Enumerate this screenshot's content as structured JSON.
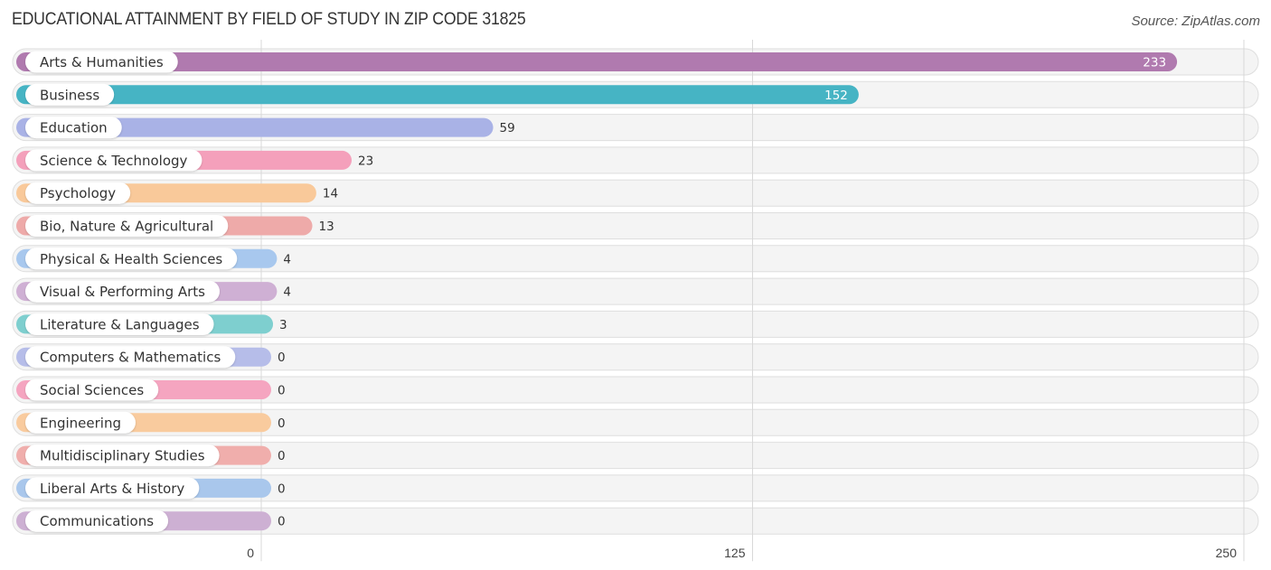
{
  "title": "EDUCATIONAL ATTAINMENT BY FIELD OF STUDY IN ZIP CODE 31825",
  "source": "Source: ZipAtlas.com",
  "chart_data": {
    "type": "bar",
    "orientation": "horizontal",
    "title": "EDUCATIONAL ATTAINMENT BY FIELD OF STUDY IN ZIP CODE 31825",
    "xlabel": "",
    "ylabel": "",
    "xlim": [
      0,
      250
    ],
    "xticks": [
      0,
      125,
      250
    ],
    "xtick_labels": [
      "0",
      "125",
      "250"
    ],
    "grid": true,
    "categories": [
      "Arts & Humanities",
      "Business",
      "Education",
      "Science & Technology",
      "Psychology",
      "Bio, Nature & Agricultural",
      "Physical & Health Sciences",
      "Visual & Performing Arts",
      "Literature & Languages",
      "Computers & Mathematics",
      "Social Sciences",
      "Engineering",
      "Multidisciplinary Studies",
      "Liberal Arts & History",
      "Communications"
    ],
    "values": [
      233,
      152,
      59,
      23,
      14,
      13,
      4,
      4,
      3,
      0,
      0,
      0,
      0,
      0,
      0
    ],
    "colors": [
      "#b07aaf",
      "#46b4c4",
      "#a9b2e6",
      "#f4a0bb",
      "#f9c99a",
      "#eeaaa9",
      "#a8c8ee",
      "#cfb0d4",
      "#7ecfcf",
      "#b6bde9",
      "#f5a5c0",
      "#f9cb9e",
      "#f0aeac",
      "#a9c7ec",
      "#cdb0d3"
    ],
    "value_labels_inside": [
      true,
      true,
      false,
      false,
      false,
      false,
      false,
      false,
      false,
      false,
      false,
      false,
      false,
      false,
      false
    ]
  }
}
